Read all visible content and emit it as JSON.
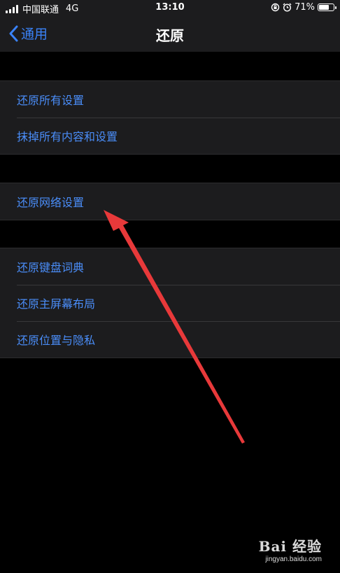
{
  "status_bar": {
    "carrier": "中国联通",
    "network": "4G",
    "time": "13:10",
    "battery_percent": "71%",
    "battery_level": 0.71
  },
  "nav": {
    "back_label": "通用",
    "title": "还原"
  },
  "groups": [
    {
      "items": [
        "还原所有设置",
        "抹掉所有内容和设置"
      ]
    },
    {
      "items": [
        "还原网络设置"
      ]
    },
    {
      "items": [
        "还原键盘词典",
        "还原主屏幕布局",
        "还原位置与隐私"
      ]
    }
  ],
  "watermark": {
    "logo": "Bai 经验",
    "url": "jingyan.baidu.com"
  },
  "colors": {
    "accent": "#3a82f7",
    "annotation_arrow": "#e8393a",
    "background": "#000000",
    "group_background": "#1c1c1e"
  }
}
